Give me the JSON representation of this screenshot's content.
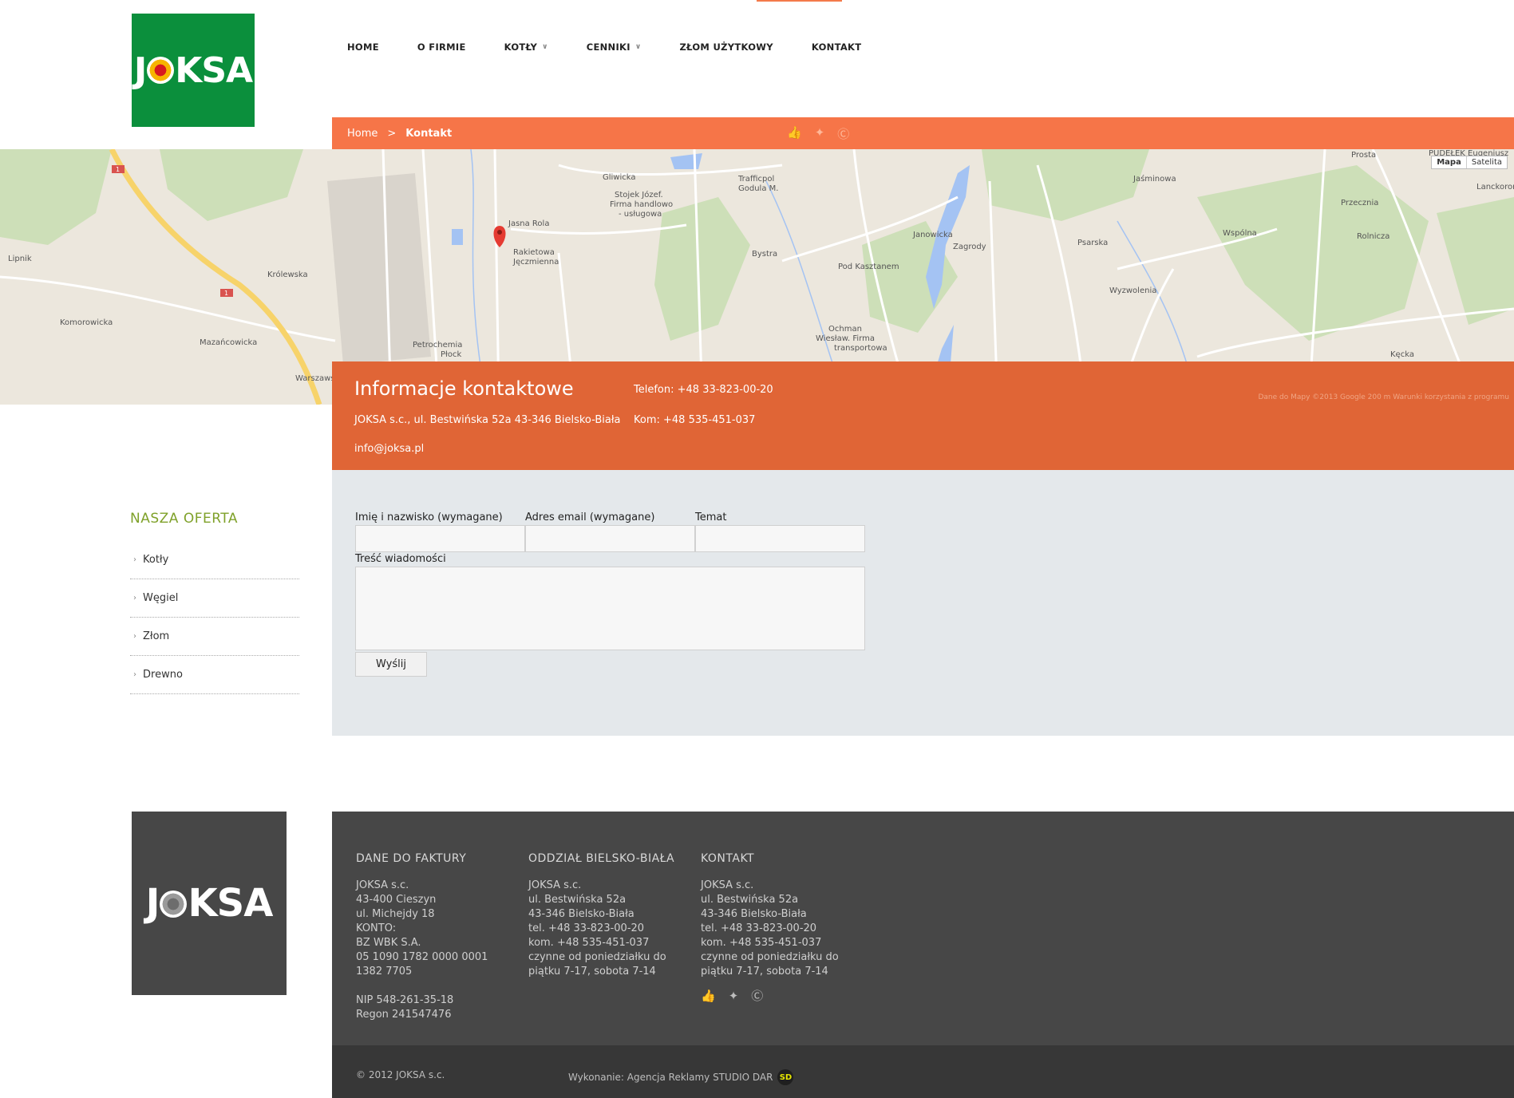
{
  "brand": {
    "logo_text": "JOKSA"
  },
  "nav": {
    "items": [
      {
        "label": "HOME",
        "has_dropdown": false
      },
      {
        "label": "O FIRMIE",
        "has_dropdown": false
      },
      {
        "label": "KOTŁY",
        "has_dropdown": true
      },
      {
        "label": "CENNIKI",
        "has_dropdown": true
      },
      {
        "label": "ZŁOM UŻYTKOWY",
        "has_dropdown": false
      },
      {
        "label": "KONTAKT",
        "has_dropdown": false
      }
    ],
    "active": "KONTAKT"
  },
  "breadcrumb": {
    "home": "Home",
    "separator": ">",
    "current": "Kontakt"
  },
  "map": {
    "controls": [
      "Mapa",
      "Satelita"
    ],
    "labels": {
      "gliwicka": "Gliwicka",
      "trafficpol": "Trafficpol",
      "godula": "Godula M.",
      "stojek": "Stojek Józef.",
      "firma": "Firma handlowo",
      "uslugowa": "- usługowa",
      "jasna": "Jasna Rola",
      "rakietowa": "Rakietowa",
      "jeczmienna": "Jęczmienna",
      "bystra": "Bystra",
      "kasztanem": "Pod Kasztanem",
      "janowicka": "Janowicka",
      "zagrody": "Zagrody",
      "krolewska": "Królewska",
      "komorowicka": "Komorowicka",
      "mazancowicka": "Mazańcowicka",
      "warszawska": "Warszawska",
      "petrochemia": "Petrochemia",
      "plock": "Płock",
      "ochman": "Ochman",
      "wieslaw": "Wiesław. Firma",
      "transportowa": "transportowa",
      "wspolna": "Wspólna",
      "rolnicza": "Rolnicza",
      "kecka": "Kęcka",
      "przecznia": "Przecznia",
      "lanckorona": "Lanckorona",
      "prosta": "Prosta",
      "pudelek": "PUDEŁEK Eugeniusz",
      "jasminowa": "Jaśminowa",
      "psarska": "Psarska",
      "wyzwolenia": "Wyzwolenia",
      "lipnik": "Lipnik",
      "road1": "1"
    },
    "credits": "Dane do Mapy ©2013 Google   200 m   Warunki korzystania z programu"
  },
  "contact_info": {
    "title": "Informacje kontaktowe",
    "address": "JOKSA s.c., ul. Bestwińska 52a 43-346 Bielsko-Biała",
    "email": "info@joksa.pl",
    "phone": "Telefon: +48 33-823-00-20",
    "mobile": "Kom: +48 535-451-037"
  },
  "sidebar": {
    "title": "NASZA OFERTA",
    "items": [
      {
        "label": "Kotły"
      },
      {
        "label": "Węgiel"
      },
      {
        "label": "Złom"
      },
      {
        "label": "Drewno"
      }
    ]
  },
  "form": {
    "name_label": "Imię i nazwisko (wymagane)",
    "email_label": "Adres email (wymagane)",
    "subject_label": "Temat",
    "message_label": "Treść wiadomości",
    "name_value": "",
    "email_value": "",
    "subject_value": "",
    "message_value": "",
    "submit_label": "Wyślij"
  },
  "footer": {
    "invoice": {
      "title": "DANE DO FAKTURY",
      "lines": [
        "JOKSA s.c.",
        "43-400 Cieszyn",
        "ul. Michejdy 18",
        "KONTO:",
        "BZ WBK S.A.",
        "05 1090 1782 0000 0001",
        "1382 7705"
      ],
      "lines2": [
        "NIP 548-261-35-18",
        "Regon 241547476"
      ]
    },
    "branch": {
      "title": "ODDZIAŁ BIELSKO-BIAŁA",
      "lines": [
        "JOKSA s.c.",
        "ul. Bestwińska 52a",
        "43-346 Bielsko-Biała",
        "tel. +48 33-823-00-20",
        "kom. +48 535-451-037",
        "czynne od poniedziałku do",
        "piątku 7-17, sobota 7-14"
      ]
    },
    "contact": {
      "title": "KONTAKT",
      "lines": [
        "JOKSA s.c.",
        "ul. Bestwińska 52a",
        "43-346 Bielsko-Biała",
        "tel. +48 33-823-00-20",
        "kom. +48 535-451-037",
        "czynne od poniedziałku do",
        "piątku 7-17, sobota 7-14"
      ]
    },
    "copyright": "© 2012 JOKSA s.c.",
    "credit": "Wykonanie: Agencja Reklamy STUDIO DAR",
    "credit_badge": "SD"
  },
  "social_icons": [
    "like-icon",
    "twitter-icon",
    "skype-icon"
  ],
  "colors": {
    "brand_green": "#0b8f3c",
    "accent_orange": "#f67548",
    "info_orange": "#e06536",
    "sidebar_title": "#7fa12a",
    "footer_bg": "#474747"
  }
}
